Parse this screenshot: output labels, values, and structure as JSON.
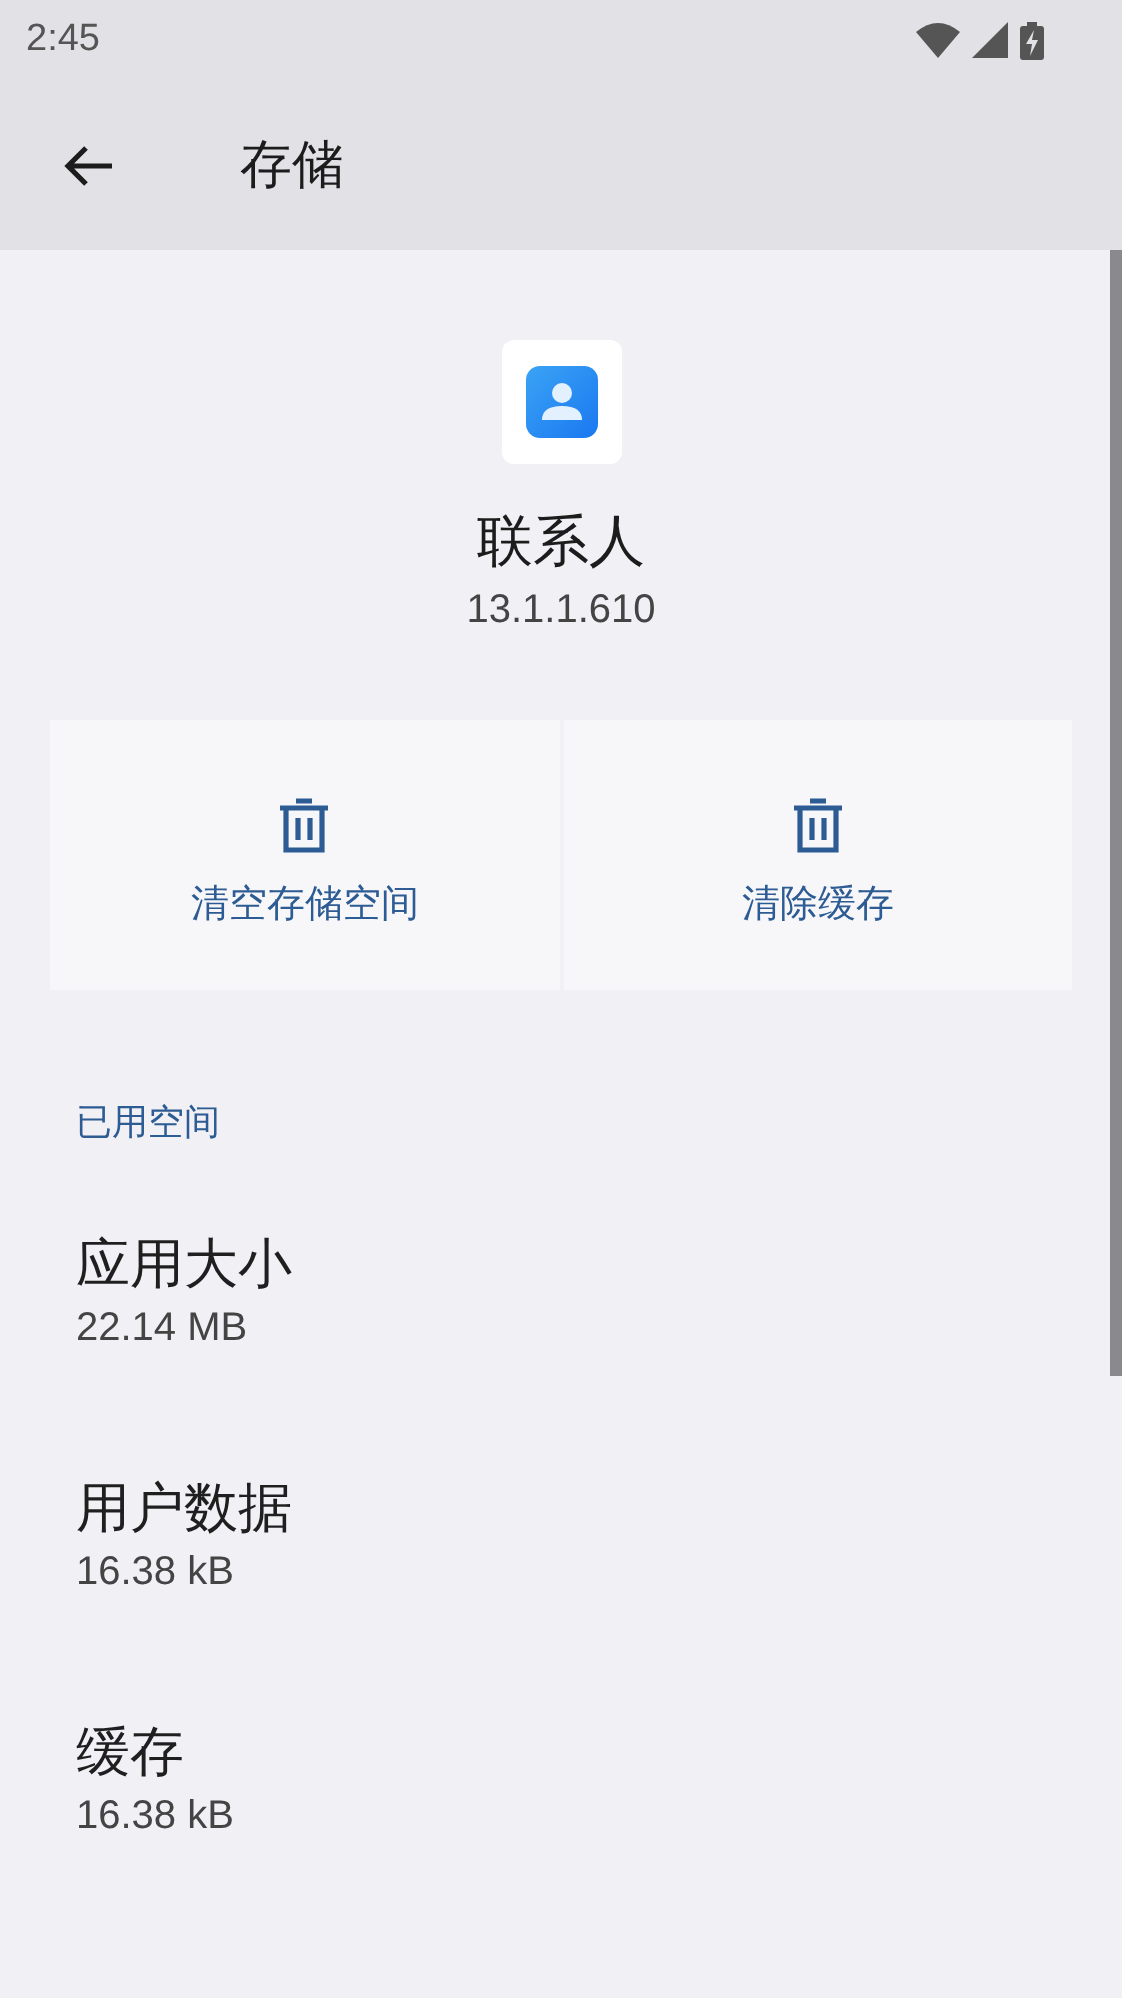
{
  "status_bar": {
    "time": "2:45"
  },
  "app_bar": {
    "title": "存储"
  },
  "app": {
    "name": "联系人",
    "version": "13.1.1.610"
  },
  "actions": [
    {
      "label": "清空存储空间"
    },
    {
      "label": "清除缓存"
    }
  ],
  "section": {
    "title": "已用空间"
  },
  "items": [
    {
      "title": "应用大小",
      "value": "22.14 MB"
    },
    {
      "title": "用户数据",
      "value": "16.38 kB"
    },
    {
      "title": "缓存",
      "value": "16.38 kB"
    }
  ]
}
